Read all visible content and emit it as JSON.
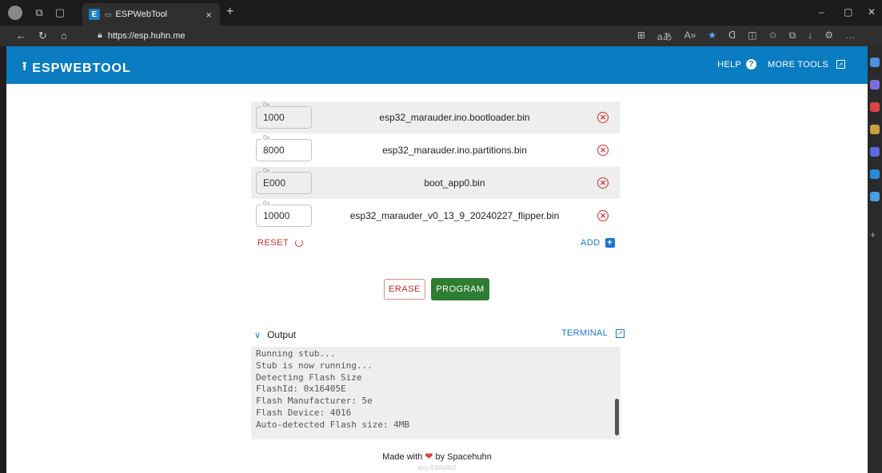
{
  "browser": {
    "tab_title": "ESPWebTool",
    "tab_favicon_letter": "E",
    "url": "https://esp.huhn.me"
  },
  "header": {
    "brand": "ESPWEBTOOL",
    "help_label": "HELP",
    "more_tools_label": "MORE TOOLS"
  },
  "files": [
    {
      "offset_prefix": "0x",
      "offset": "1000",
      "name": "esp32_marauder.ino.bootloader.bin"
    },
    {
      "offset_prefix": "0x",
      "offset": "8000",
      "name": "esp32_marauder.ino.partitions.bin"
    },
    {
      "offset_prefix": "0x",
      "offset": "E000",
      "name": "boot_app0.bin"
    },
    {
      "offset_prefix": "0x",
      "offset": "10000",
      "name": "esp32_marauder_v0_13_9_20240227_flipper.bin"
    }
  ],
  "actions": {
    "reset_label": "RESET",
    "add_label": "ADD",
    "erase_label": "ERASE",
    "program_label": "PROGRAM"
  },
  "output": {
    "title": "Output",
    "terminal_label": "TERMINAL",
    "lines": [
      "Running stub...",
      "Stub is now running...",
      "Detecting Flash Size",
      "FlashId: 0x16405E",
      "Flash Manufacturer: 5e",
      "Flash Device: 4016",
      "Auto-detected Flash size: 4MB"
    ]
  },
  "footer": {
    "made_with": "Made with",
    "by": "by Spacehuhn",
    "version": "dev 83bfa9b2"
  },
  "colors": {
    "header_bg": "#0a7cc1",
    "program_green": "#2e7d32",
    "erase_red": "#c62828",
    "link_blue": "#1976d2"
  }
}
